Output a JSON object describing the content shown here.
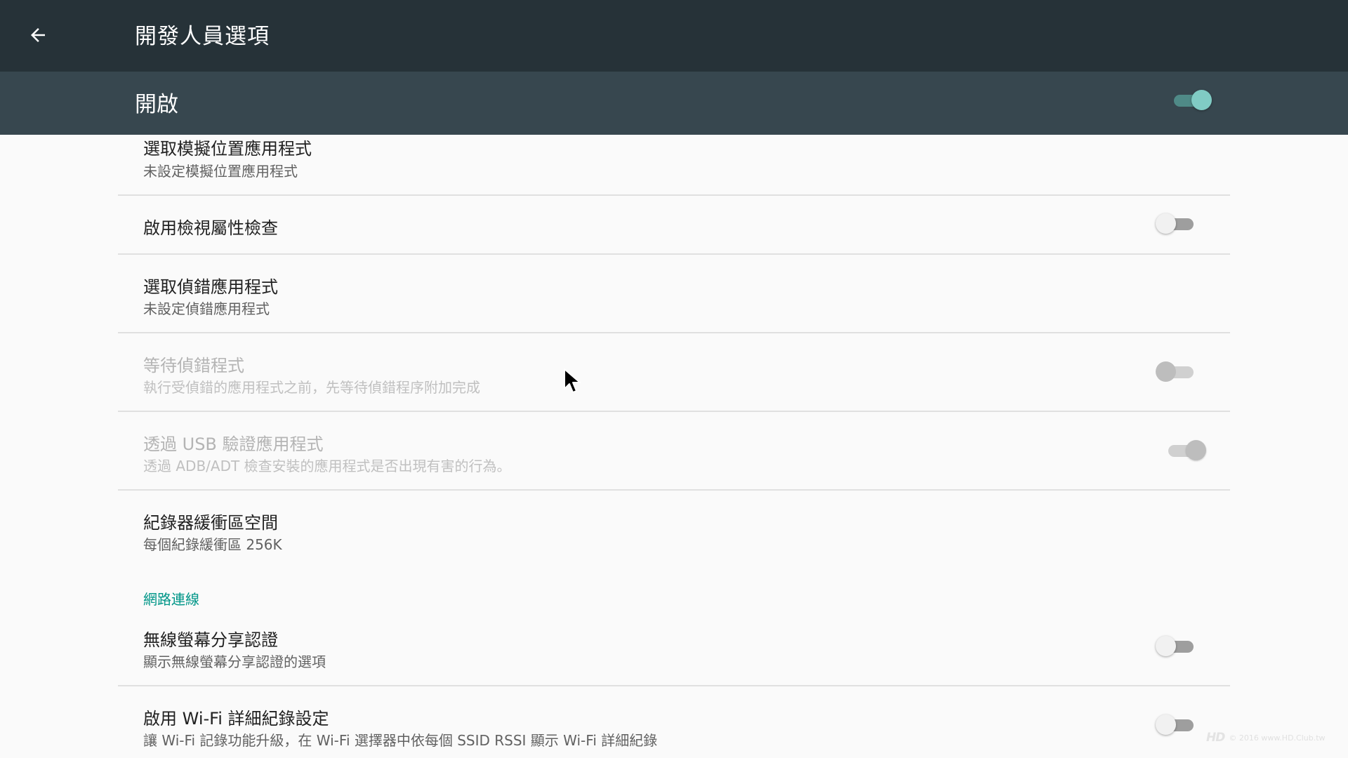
{
  "header": {
    "title": "開發人員選項",
    "back_icon": "arrow-back-icon"
  },
  "master_switch": {
    "label": "開啟",
    "state": "on"
  },
  "items": [
    {
      "title": "選取模擬位置應用程式",
      "summary": "未設定模擬位置應用程式"
    },
    {
      "title": "啟用檢視屬性檢查",
      "switch": "off"
    },
    {
      "title": "選取偵錯應用程式",
      "summary": "未設定偵錯應用程式"
    },
    {
      "title": "等待偵錯程式",
      "summary": "執行受偵錯的應用程式之前，先等待偵錯程序附加完成",
      "switch": "off",
      "disabled": true
    },
    {
      "title": "透過 USB 驗證應用程式",
      "summary": "透過 ADB/ADT 檢查安裝的應用程式是否出現有害的行為。",
      "switch": "on",
      "disabled": true
    },
    {
      "title": "紀錄器緩衝區空間",
      "summary": "每個紀錄緩衝區 256K"
    },
    {
      "title": "無線螢幕分享認證",
      "summary": "顯示無線螢幕分享認證的選項",
      "switch": "off"
    },
    {
      "title": "啟用 Wi-Fi 詳細紀錄設定",
      "summary": "讓 Wi-Fi 記錄功能升級，在 Wi-Fi 選擇器中依每個 SSID RSSI 顯示 Wi-Fi 詳細紀錄",
      "switch": "off"
    }
  ],
  "category": {
    "networking": "網路連線"
  },
  "watermark": {
    "logo": "HD",
    "text": "© 2016 www.HD.Club.tw"
  },
  "colors": {
    "toolbar": "#263238",
    "master_bar": "#37474f",
    "accent": "#009688",
    "switch_on_thumb": "#80cbc4"
  }
}
